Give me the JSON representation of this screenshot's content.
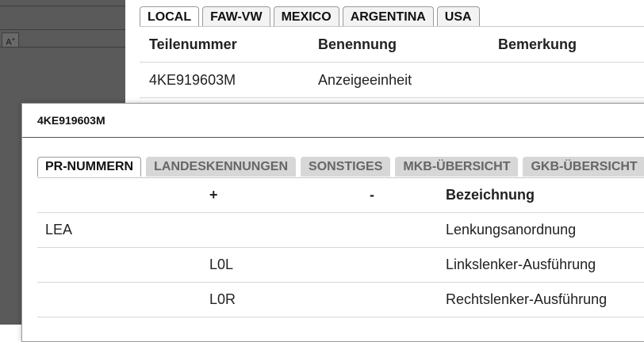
{
  "sidebar": {
    "font_toggle_label": "A",
    "font_toggle_sup": "+"
  },
  "background_panel": {
    "tabs": [
      "LOCAL",
      "FAW-VW",
      "MEXICO",
      "ARGENTINA",
      "USA"
    ],
    "active_tab": "LOCAL",
    "table": {
      "headers": [
        "Teilenummer",
        "Benennung",
        "Bemerkung"
      ],
      "rows": [
        [
          "4KE919603M",
          "Anzeigeeinheit",
          ""
        ]
      ]
    }
  },
  "dialog": {
    "title": "4KE919603M",
    "tabs": [
      "PR-NUMMERN",
      "LANDESKENNUNGEN",
      "SONSTIGES",
      "MKB-ÜBERSICHT",
      "GKB-ÜBERSICHT"
    ],
    "active_tab": "PR-NUMMERN",
    "table": {
      "headers": [
        "",
        "+",
        "-",
        "Bezeichnung"
      ],
      "rows": [
        [
          "LEA",
          "",
          "",
          "Lenkungsanordnung"
        ],
        [
          "",
          "L0L",
          "",
          "Linkslenker-Ausführung"
        ],
        [
          "",
          "L0R",
          "",
          "Rechtslenker-Ausführung"
        ]
      ]
    }
  },
  "colors": {
    "sidebar_bg": "#5a5a5a",
    "inactive_tab_bg": "#d7d7d7",
    "row_divider": "#d6d6d6"
  }
}
